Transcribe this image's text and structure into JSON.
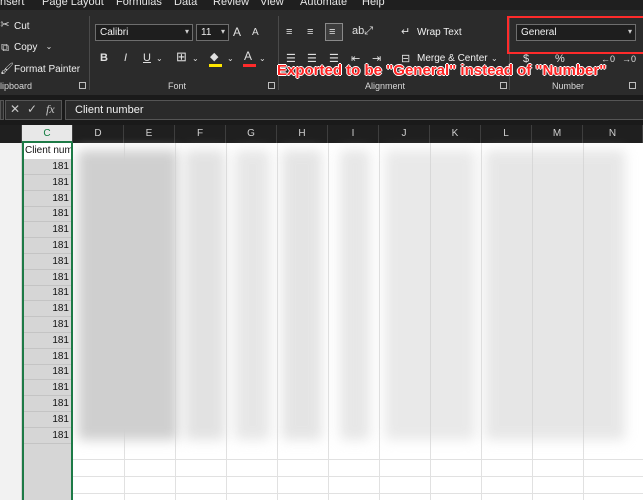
{
  "menu": [
    "nsert",
    "Page Layout",
    "Formulas",
    "Data",
    "Review",
    "View",
    "Automate",
    "Help"
  ],
  "clipboard": {
    "cut": "Cut",
    "copy": "Copy",
    "format_painter": "Format Painter",
    "group_label": "lipboard"
  },
  "font": {
    "name": "Calibri",
    "size": "11",
    "group_label": "Font",
    "bold": "B",
    "italic": "I",
    "underline": "U",
    "grow": "A",
    "shrink": "A",
    "font_color_glyph": "A"
  },
  "alignment": {
    "wrap_text": "Wrap Text",
    "merge_center": "Merge & Center",
    "group_label": "Alignment"
  },
  "number": {
    "format": "General",
    "group_label": "Number",
    "currency": "$",
    "percent": "%"
  },
  "annotation": "Exported to be \"General\" instead of \"Number\"",
  "formula_bar": {
    "value": "Client number",
    "cancel": "✕",
    "enter": "✓",
    "fx": "fx"
  },
  "columns": [
    "C",
    "D",
    "E",
    "F",
    "G",
    "H",
    "I",
    "J",
    "K",
    "L",
    "M",
    "N"
  ],
  "column_c": {
    "header_cell": "Client number",
    "values": [
      "181",
      "181",
      "181",
      "181",
      "181",
      "181",
      "181",
      "181",
      "181",
      "181",
      "181",
      "181",
      "181",
      "181",
      "181",
      "181",
      "181",
      "181"
    ]
  },
  "colors": {
    "ribbon_bg": "#2b2b2b",
    "highlight": "#ff2b2b",
    "selection": "#1d7a46",
    "annotation_text": "#ff2323"
  }
}
